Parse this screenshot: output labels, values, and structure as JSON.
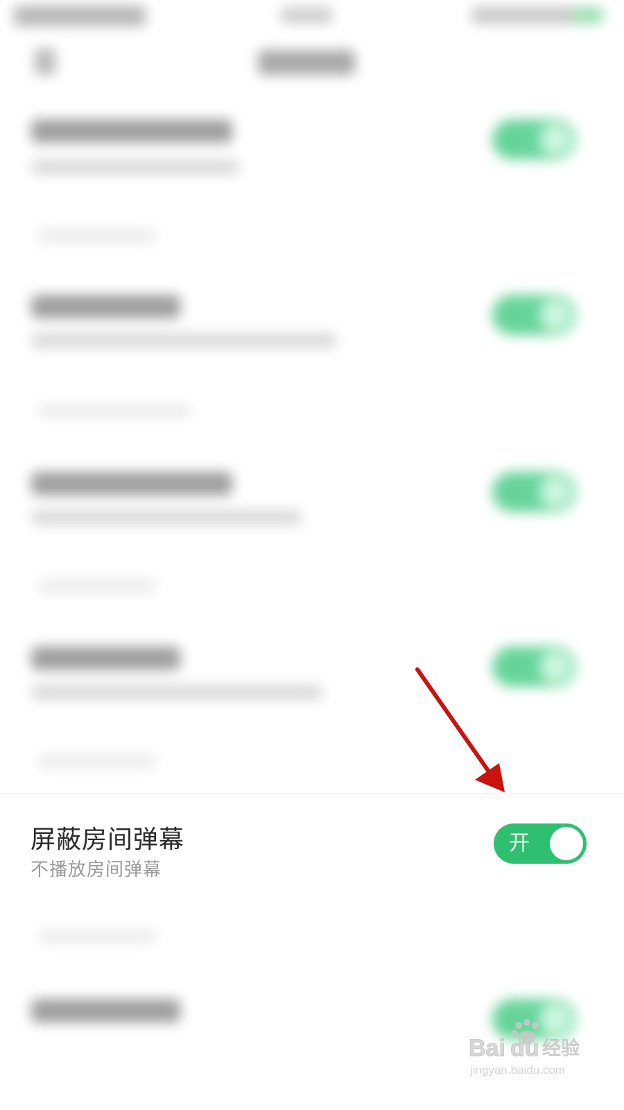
{
  "setting": {
    "title": "屏蔽房间弹幕",
    "subtitle": "不播放房间弹幕",
    "toggle_label": "开",
    "toggle_state": "on"
  },
  "colors": {
    "toggle_on": "#2fbf71",
    "arrow": "#c8130f"
  },
  "watermark": {
    "brand": "Baidu经验",
    "url": "jingyan.baidu.com"
  }
}
